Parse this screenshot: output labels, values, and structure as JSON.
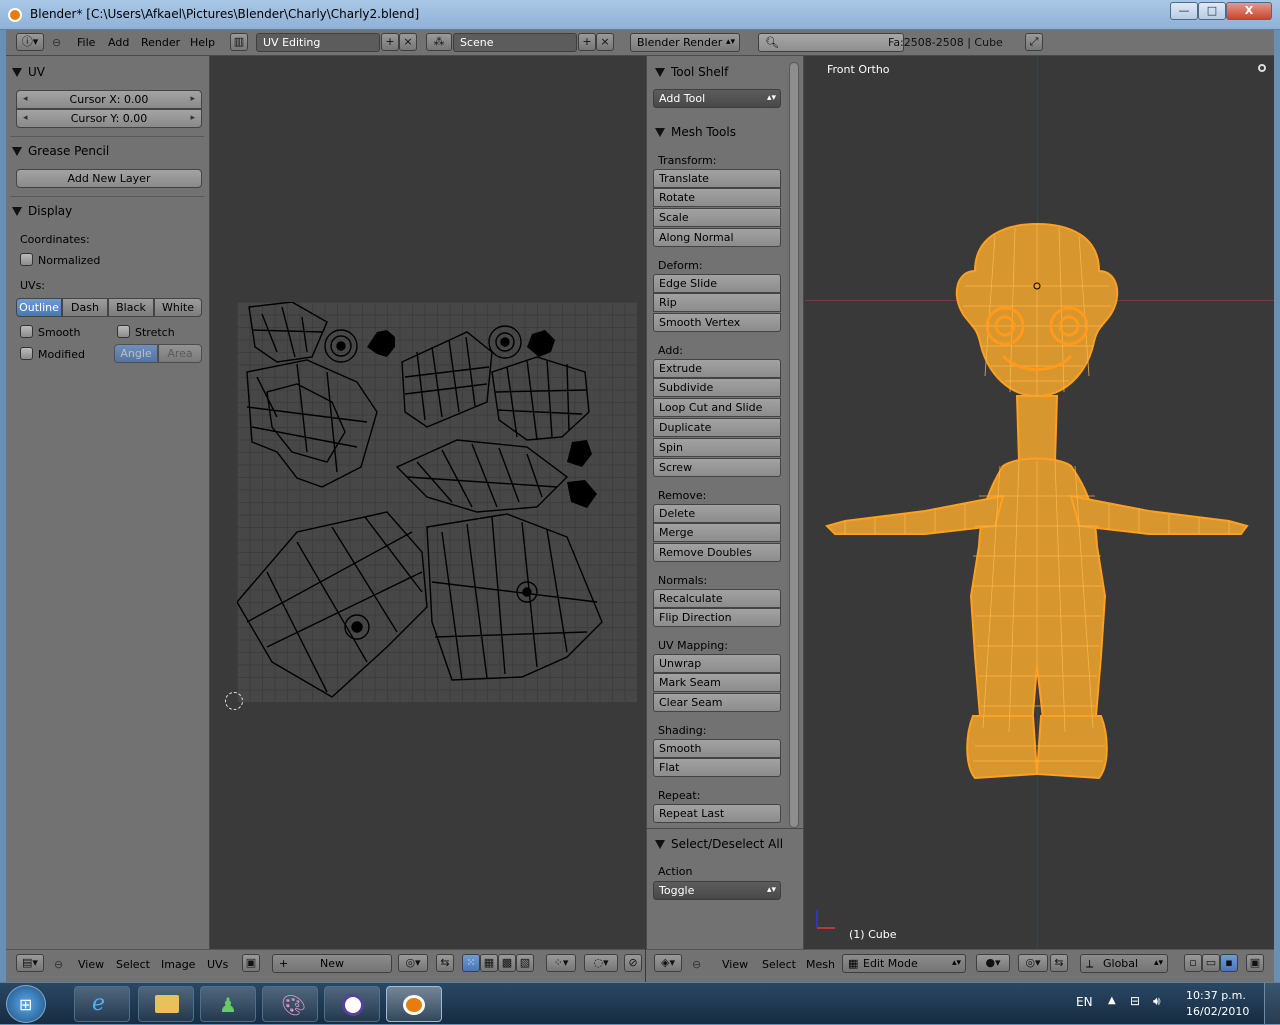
{
  "window": {
    "title": "Blender* [C:\\Users\\Afkael\\Pictures\\Blender\\Charly\\Charly2.blend]",
    "min": "—",
    "max": "□",
    "close": "X"
  },
  "info_header": {
    "menus": [
      "File",
      "Add",
      "Render",
      "Help"
    ],
    "screen_layout": "UV Editing",
    "scene": "Scene",
    "engine": "Blender Render",
    "search_placeholder": "",
    "stats": "Fa:2508-2508 | Cube"
  },
  "uv_panel": {
    "sections": {
      "uv": "UV",
      "grease": "Grease Pencil",
      "display": "Display"
    },
    "cursor_x": "Cursor X: 0.00",
    "cursor_y": "Cursor Y: 0.00",
    "add_layer": "Add New Layer",
    "coordinates_label": "Coordinates:",
    "normalized": "Normalized",
    "uvs_label": "UVs:",
    "uv_modes": [
      "Outline",
      "Dash",
      "Black",
      "White"
    ],
    "smooth": "Smooth",
    "stretch": "Stretch",
    "modified": "Modified",
    "angle": "Angle",
    "area": "Area"
  },
  "uv_header": {
    "menus": [
      "View",
      "Select",
      "Image",
      "UVs"
    ],
    "new_label": "New"
  },
  "tool_shelf": {
    "title": "Tool Shelf",
    "add_tool": "Add Tool",
    "mesh_tools": "Mesh Tools",
    "groups": [
      {
        "label": "Transform:",
        "buttons": [
          "Translate",
          "Rotate",
          "Scale",
          "Along Normal"
        ]
      },
      {
        "label": "Deform:",
        "buttons": [
          "Edge Slide",
          "Rip",
          "Smooth Vertex"
        ]
      },
      {
        "label": "Add:",
        "buttons": [
          "Extrude",
          "Subdivide",
          "Loop Cut and Slide",
          "Duplicate",
          "Spin",
          "Screw"
        ]
      },
      {
        "label": "Remove:",
        "buttons": [
          "Delete",
          "Merge",
          "Remove Doubles"
        ]
      },
      {
        "label": "Normals:",
        "buttons": [
          "Recalculate",
          "Flip Direction"
        ]
      },
      {
        "label": "UV Mapping:",
        "buttons": [
          "Unwrap",
          "Mark Seam",
          "Clear Seam"
        ]
      },
      {
        "label": "Shading:",
        "buttons": [
          "Smooth",
          "Flat"
        ]
      },
      {
        "label": "Repeat:",
        "buttons": [
          "Repeat Last"
        ]
      }
    ],
    "select_title": "Select/Deselect All",
    "action_label": "Action",
    "action_value": "Toggle"
  },
  "view3d": {
    "view_name": "Front Ortho",
    "object_label": "(1) Cube",
    "menus": [
      "View",
      "Select",
      "Mesh"
    ],
    "mode": "Edit Mode",
    "orientation": "Global"
  },
  "taskbar": {
    "language": "EN",
    "time": "10:37 p.m.",
    "date": "16/02/2010"
  },
  "colors": {
    "selection_orange": "#ffa020",
    "accent_blue": "#4a76b6"
  }
}
